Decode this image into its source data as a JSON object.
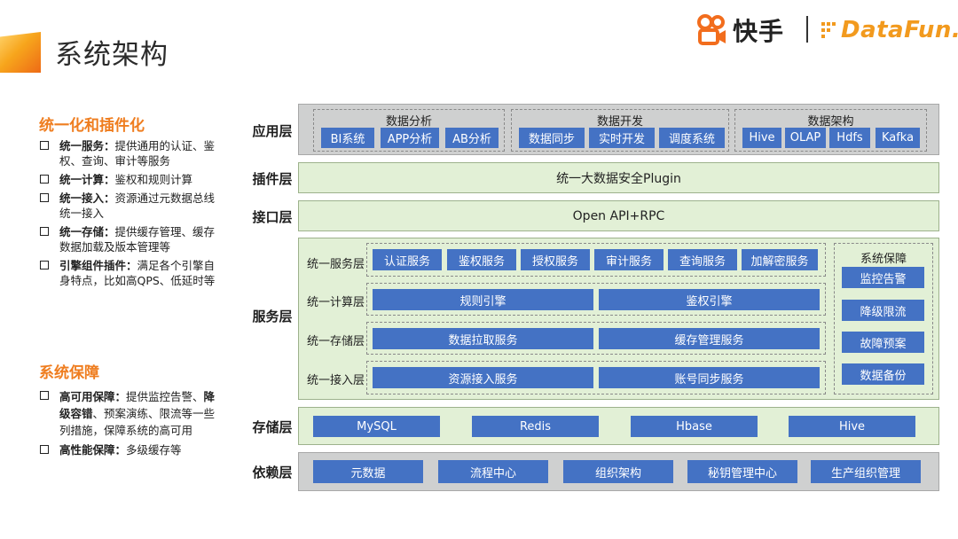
{
  "header": {
    "title": "系统架构",
    "logo_kuaishou": "快手",
    "logo_datafun": "DataFun."
  },
  "left": {
    "sections": [
      {
        "title": "统一化和插件化",
        "items": [
          {
            "bold": "统一服务：",
            "text": "提供通用的认证、鉴权、查询、审计等服务"
          },
          {
            "bold": "统一计算：",
            "text": "鉴权和规则计算"
          },
          {
            "bold": "统一接入：",
            "text": "资源通过元数据总线统一接入"
          },
          {
            "bold": "统一存储：",
            "text": "提供缓存管理、缓存数据加载及版本管理等"
          },
          {
            "bold": "引擎组件插件：",
            "text": "满足各个引擎自身特点，比如高QPS、低延时等"
          }
        ]
      },
      {
        "title": "系统保障",
        "items": [
          {
            "bold": "高可用保障：",
            "text": "提供监控告警、",
            "bold2": "降级容错",
            "text2": "、预案演练、限流等一些列措施，保障系统的高可用"
          },
          {
            "bold": "高性能保障：",
            "text": "多级缓存等"
          }
        ]
      }
    ]
  },
  "diagram": {
    "layers": {
      "app": "应用层",
      "plugin": "插件层",
      "interface": "接口层",
      "service": "服务层",
      "storage": "存储层",
      "dependency": "依赖层"
    },
    "app_groups": [
      {
        "title": "数据分析",
        "items": [
          "BI系统",
          "APP分析",
          "AB分析"
        ]
      },
      {
        "title": "数据开发",
        "items": [
          "数据同步",
          "实时开发",
          "调度系统"
        ]
      },
      {
        "title": "数据架构",
        "items": [
          "Hive",
          "OLAP",
          "Hdfs",
          "Kafka"
        ]
      }
    ],
    "plugin_text": "统一大数据安全Plugin",
    "interface_text": "Open API+RPC",
    "service_rows": [
      {
        "label": "统一服务层",
        "items": [
          "认证服务",
          "鉴权服务",
          "授权服务",
          "审计服务",
          "查询服务",
          "加解密服务"
        ]
      },
      {
        "label": "统一计算层",
        "items": [
          "规则引擎",
          "鉴权引擎"
        ]
      },
      {
        "label": "统一存储层",
        "items": [
          "数据拉取服务",
          "缓存管理服务"
        ]
      },
      {
        "label": "统一接入层",
        "items": [
          "资源接入服务",
          "账号同步服务"
        ]
      }
    ],
    "guarantee": {
      "title": "系统保障",
      "items": [
        "监控告警",
        "降级限流",
        "故障预案",
        "数据备份"
      ]
    },
    "storage_items": [
      "MySQL",
      "Redis",
      "Hbase",
      "Hive"
    ],
    "dependency_items": [
      "元数据",
      "流程中心",
      "组织架构",
      "秘钥管理中心",
      "生产组织管理"
    ],
    "colors": {
      "button": "#4472c4",
      "layer_green": "#e2f0d6",
      "layer_gray": "#cfd0d0",
      "accent": "#ef7d1f"
    }
  }
}
